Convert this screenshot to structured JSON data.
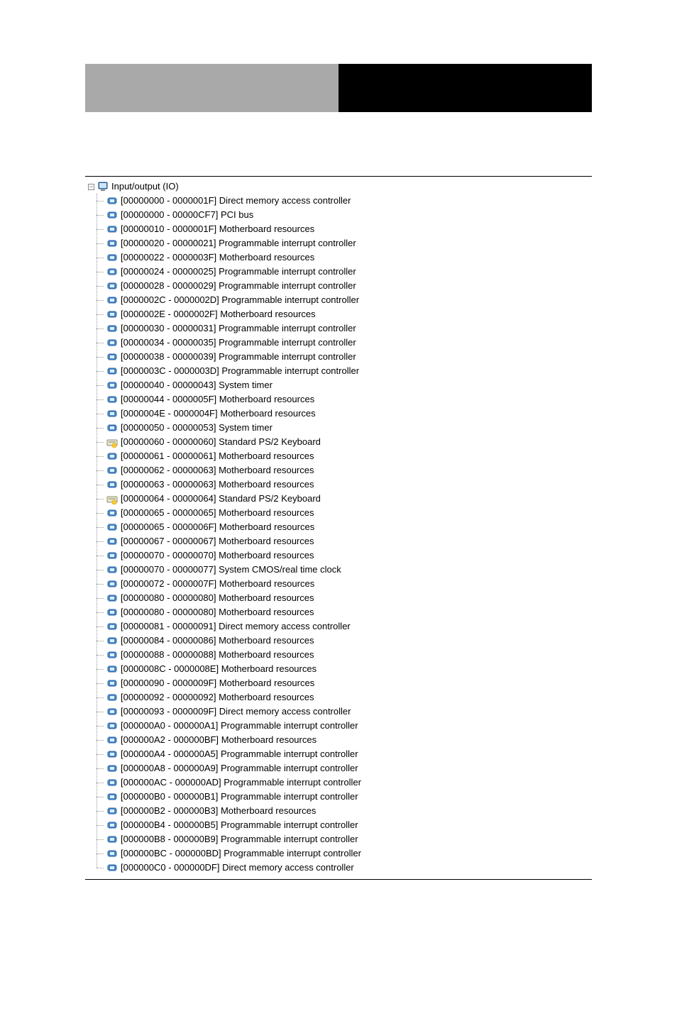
{
  "header": {
    "left_text": "",
    "right_text": ""
  },
  "tree": {
    "root": {
      "label": "Input/output (IO)",
      "icon": "computer-icon",
      "expanded": true
    },
    "items": [
      {
        "range": "[00000000 - 0000001F]",
        "name": "Direct memory access controller",
        "icon": "chip-icon"
      },
      {
        "range": "[00000000 - 00000CF7]",
        "name": "PCI bus",
        "icon": "chip-icon"
      },
      {
        "range": "[00000010 - 0000001F]",
        "name": "Motherboard resources",
        "icon": "chip-icon"
      },
      {
        "range": "[00000020 - 00000021]",
        "name": "Programmable interrupt controller",
        "icon": "chip-icon"
      },
      {
        "range": "[00000022 - 0000003F]",
        "name": "Motherboard resources",
        "icon": "chip-icon"
      },
      {
        "range": "[00000024 - 00000025]",
        "name": "Programmable interrupt controller",
        "icon": "chip-icon"
      },
      {
        "range": "[00000028 - 00000029]",
        "name": "Programmable interrupt controller",
        "icon": "chip-icon"
      },
      {
        "range": "[0000002C - 0000002D]",
        "name": "Programmable interrupt controller",
        "icon": "chip-icon"
      },
      {
        "range": "[0000002E - 0000002F]",
        "name": "Motherboard resources",
        "icon": "chip-icon"
      },
      {
        "range": "[00000030 - 00000031]",
        "name": "Programmable interrupt controller",
        "icon": "chip-icon"
      },
      {
        "range": "[00000034 - 00000035]",
        "name": "Programmable interrupt controller",
        "icon": "chip-icon"
      },
      {
        "range": "[00000038 - 00000039]",
        "name": "Programmable interrupt controller",
        "icon": "chip-icon"
      },
      {
        "range": "[0000003C - 0000003D]",
        "name": "Programmable interrupt controller",
        "icon": "chip-icon"
      },
      {
        "range": "[00000040 - 00000043]",
        "name": "System timer",
        "icon": "chip-icon"
      },
      {
        "range": "[00000044 - 0000005F]",
        "name": "Motherboard resources",
        "icon": "chip-icon"
      },
      {
        "range": "[0000004E - 0000004F]",
        "name": "Motherboard resources",
        "icon": "chip-icon"
      },
      {
        "range": "[00000050 - 00000053]",
        "name": "System timer",
        "icon": "chip-icon"
      },
      {
        "range": "[00000060 - 00000060]",
        "name": "Standard PS/2 Keyboard",
        "icon": "keyboard-icon"
      },
      {
        "range": "[00000061 - 00000061]",
        "name": "Motherboard resources",
        "icon": "chip-icon"
      },
      {
        "range": "[00000062 - 00000063]",
        "name": "Motherboard resources",
        "icon": "chip-icon"
      },
      {
        "range": "[00000063 - 00000063]",
        "name": "Motherboard resources",
        "icon": "chip-icon"
      },
      {
        "range": "[00000064 - 00000064]",
        "name": "Standard PS/2 Keyboard",
        "icon": "keyboard-icon"
      },
      {
        "range": "[00000065 - 00000065]",
        "name": "Motherboard resources",
        "icon": "chip-icon"
      },
      {
        "range": "[00000065 - 0000006F]",
        "name": "Motherboard resources",
        "icon": "chip-icon"
      },
      {
        "range": "[00000067 - 00000067]",
        "name": "Motherboard resources",
        "icon": "chip-icon"
      },
      {
        "range": "[00000070 - 00000070]",
        "name": "Motherboard resources",
        "icon": "chip-icon"
      },
      {
        "range": "[00000070 - 00000077]",
        "name": "System CMOS/real time clock",
        "icon": "chip-icon"
      },
      {
        "range": "[00000072 - 0000007F]",
        "name": "Motherboard resources",
        "icon": "chip-icon"
      },
      {
        "range": "[00000080 - 00000080]",
        "name": "Motherboard resources",
        "icon": "chip-icon"
      },
      {
        "range": "[00000080 - 00000080]",
        "name": "Motherboard resources",
        "icon": "chip-icon"
      },
      {
        "range": "[00000081 - 00000091]",
        "name": "Direct memory access controller",
        "icon": "chip-icon"
      },
      {
        "range": "[00000084 - 00000086]",
        "name": "Motherboard resources",
        "icon": "chip-icon"
      },
      {
        "range": "[00000088 - 00000088]",
        "name": "Motherboard resources",
        "icon": "chip-icon"
      },
      {
        "range": "[0000008C - 0000008E]",
        "name": "Motherboard resources",
        "icon": "chip-icon"
      },
      {
        "range": "[00000090 - 0000009F]",
        "name": "Motherboard resources",
        "icon": "chip-icon"
      },
      {
        "range": "[00000092 - 00000092]",
        "name": "Motherboard resources",
        "icon": "chip-icon"
      },
      {
        "range": "[00000093 - 0000009F]",
        "name": "Direct memory access controller",
        "icon": "chip-icon"
      },
      {
        "range": "[000000A0 - 000000A1]",
        "name": "Programmable interrupt controller",
        "icon": "chip-icon"
      },
      {
        "range": "[000000A2 - 000000BF]",
        "name": "Motherboard resources",
        "icon": "chip-icon"
      },
      {
        "range": "[000000A4 - 000000A5]",
        "name": "Programmable interrupt controller",
        "icon": "chip-icon"
      },
      {
        "range": "[000000A8 - 000000A9]",
        "name": "Programmable interrupt controller",
        "icon": "chip-icon"
      },
      {
        "range": "[000000AC - 000000AD]",
        "name": "Programmable interrupt controller",
        "icon": "chip-icon"
      },
      {
        "range": "[000000B0 - 000000B1]",
        "name": "Programmable interrupt controller",
        "icon": "chip-icon"
      },
      {
        "range": "[000000B2 - 000000B3]",
        "name": "Motherboard resources",
        "icon": "chip-icon"
      },
      {
        "range": "[000000B4 - 000000B5]",
        "name": "Programmable interrupt controller",
        "icon": "chip-icon"
      },
      {
        "range": "[000000B8 - 000000B9]",
        "name": "Programmable interrupt controller",
        "icon": "chip-icon"
      },
      {
        "range": "[000000BC - 000000BD]",
        "name": "Programmable interrupt controller",
        "icon": "chip-icon"
      },
      {
        "range": "[000000C0 - 000000DF]",
        "name": "Direct memory access controller",
        "icon": "chip-icon"
      }
    ]
  }
}
